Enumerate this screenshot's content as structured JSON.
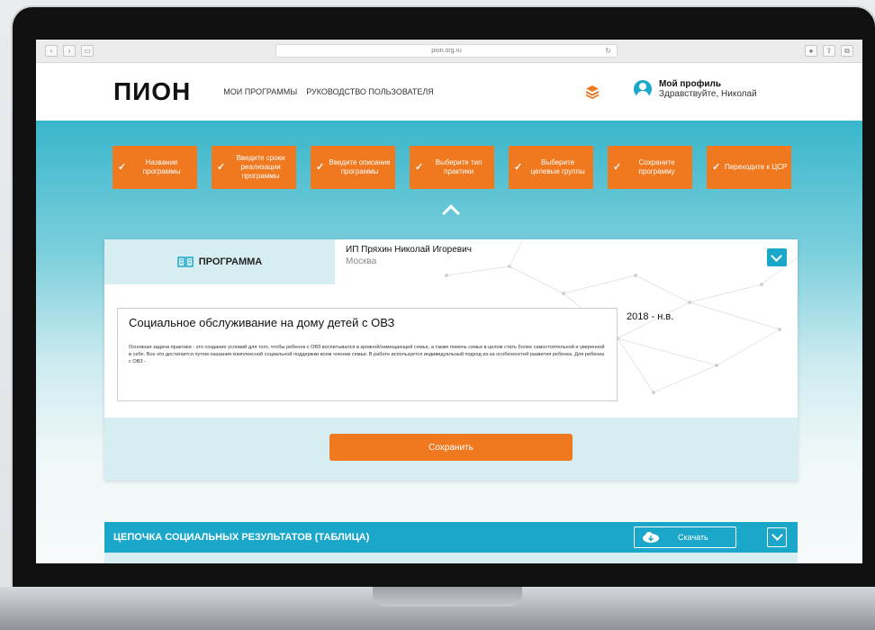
{
  "browser": {
    "url": "pion.org.ru",
    "back_icon": "chevron-left-icon",
    "forward_icon": "chevron-right-icon"
  },
  "header": {
    "logo": "ПИОН",
    "nav": [
      "МОИ ПРОГРАММЫ",
      "РУКОВОДСТВО ПОЛЬЗОВАТЕЛЯ"
    ],
    "profile_title": "Мой профиль",
    "profile_greeting": "Здравствуйте, Николай"
  },
  "steps": [
    {
      "label": "Название программы"
    },
    {
      "label": "Введите сроки реализации программы"
    },
    {
      "label": "Введите описание программы"
    },
    {
      "label": "Выберите тип практики"
    },
    {
      "label": "Выберите целевые группы"
    },
    {
      "label": "Сохраните программу"
    },
    {
      "label": "Переходите к ЦСР"
    }
  ],
  "program_card": {
    "tab_label": "ПРОГРАММА",
    "owner_name": "ИП Пряхин Николай Игоревич",
    "owner_city": "Москва",
    "program_title": "Социальное обслуживание на дому детей с ОВЗ",
    "program_description": "Основная задача практики - это создание условий для того, чтобы ребенок с ОВЗ воспитывался в кровной/замещающей семье, а также помочь семье в целом стать более самостоятельной и уверенной в себе. Все это достигается путем оказания комплексной социальной поддержки всем членам семьи. В работе используется индивидуальный подход из-за особенностей развития ребенка. Для ребенка с ОВЗ -",
    "years": "2018 - н.в.",
    "save_label": "Сохранить"
  },
  "chain": {
    "title": "ЦЕПОЧКА СОЦИАЛЬНЫХ РЕЗУЛЬТАТОВ (ТАБЛИЦА)",
    "download_label": "Скачать"
  },
  "colors": {
    "accent": "#f0781e",
    "teal": "#1aa7c9",
    "light_teal": "#d6eef2"
  }
}
